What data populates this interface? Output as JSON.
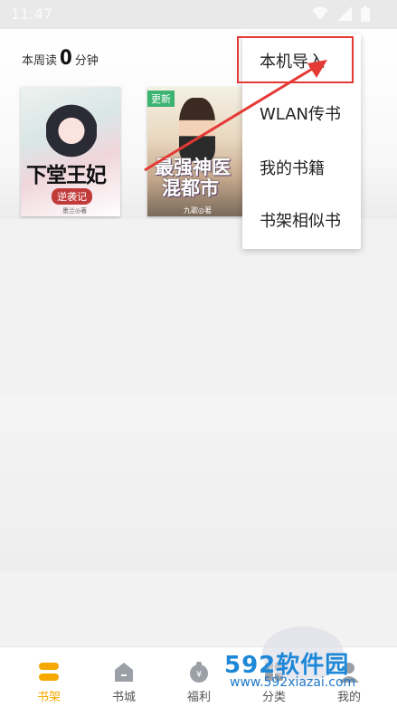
{
  "status_bar": {
    "time": "11:47"
  },
  "reading": {
    "prefix": "本周读",
    "minutes": "0",
    "suffix": "分钟"
  },
  "books": [
    {
      "title": "下堂王妃",
      "subtitle": "逆袭记",
      "author": "墨兰◎著",
      "badge": ""
    },
    {
      "title_line1": "最强神医",
      "title_line2": "混都市",
      "author": "九歌◎著",
      "badge": "更新"
    }
  ],
  "menu": {
    "items": [
      "本机导入",
      "WLAN传书",
      "我的书籍",
      "书架相似书"
    ]
  },
  "tabs": [
    {
      "label": "书架",
      "icon": "bookshelf-icon",
      "active": true
    },
    {
      "label": "书城",
      "icon": "store-icon",
      "active": false
    },
    {
      "label": "福利",
      "icon": "gift-icon",
      "active": false
    },
    {
      "label": "分类",
      "icon": "category-icon",
      "active": false
    },
    {
      "label": "我的",
      "icon": "user-icon",
      "active": false
    }
  ],
  "watermark": {
    "logo_num": "592",
    "logo_cn": "软件园",
    "url": "www.592xiazai.com"
  },
  "colors": {
    "accent": "#f5a800",
    "highlight": "#e53935",
    "watermark": "#1e88d8"
  }
}
